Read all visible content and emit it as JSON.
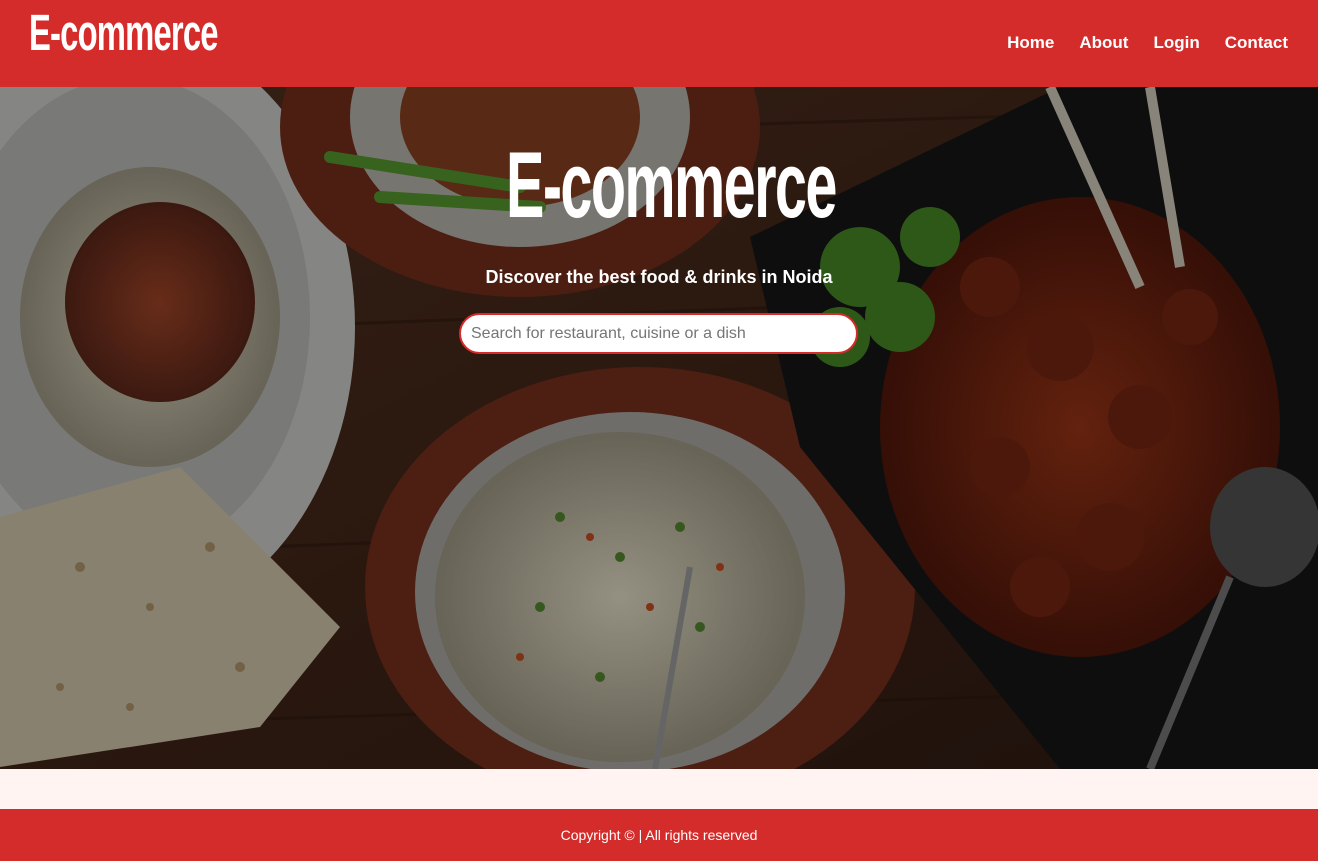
{
  "navbar": {
    "logo_text": "E-commerce",
    "links": [
      "Home",
      "About",
      "Login",
      "Contact"
    ]
  },
  "hero": {
    "logo_text": "E-commerce",
    "tagline": "Discover the best food & drinks in Noida",
    "search_placeholder": "Search for restaurant, cuisine or a dish"
  },
  "footer": {
    "copyright": "Copyright © | All rights reserved"
  },
  "colors": {
    "brand": "#d42b2b",
    "page_background": "#fff4f2"
  }
}
